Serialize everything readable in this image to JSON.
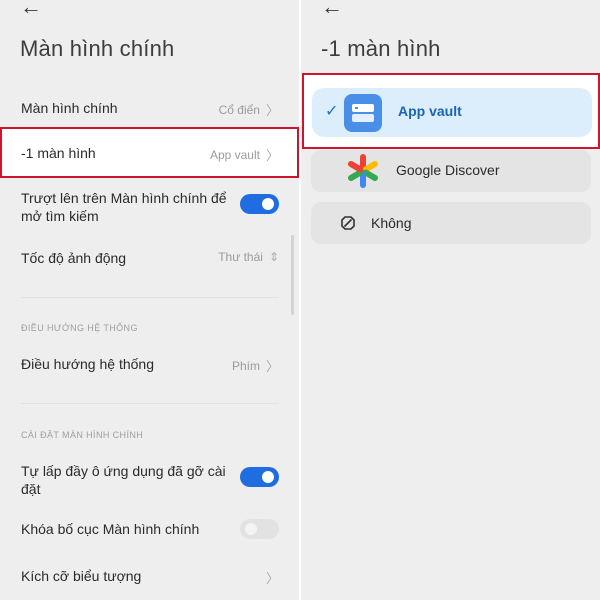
{
  "left": {
    "title": "Màn hình chính",
    "rows": [
      {
        "label": "Màn hình chính",
        "value": "Cổ điển"
      },
      {
        "label": "-1 màn hình",
        "value": "App vault"
      },
      {
        "label": "Trượt lên trên Màn hình chính để mở tìm kiếm",
        "toggle": "on"
      },
      {
        "label": "Tốc độ ảnh động",
        "value": "Thư thái"
      }
    ],
    "section_nav": {
      "header": "ĐIỀU HƯỚNG HỆ THỐNG",
      "row": {
        "label": "Điều hướng hệ thống",
        "value": "Phím"
      }
    },
    "section_home": {
      "header": "CÀI ĐẶT MÀN HÌNH CHÍNH",
      "rows": [
        {
          "label": "Tự lấp đầy ô ứng dụng đã gỡ cài đặt",
          "toggle": "on"
        },
        {
          "label": "Khóa bố cục Màn hình chính",
          "toggle": "off"
        },
        {
          "label": "Kích cỡ biểu tượng"
        }
      ]
    }
  },
  "right": {
    "title": "-1 màn hình",
    "options": [
      {
        "label": "App vault",
        "selected": true,
        "icon": "app-vault-icon"
      },
      {
        "label": "Google Discover",
        "selected": false,
        "icon": "google-discover-icon"
      },
      {
        "label": "Không",
        "selected": false,
        "icon": "block-icon"
      }
    ]
  },
  "colors": {
    "accent": "#1f6de0",
    "highlight_border": "#d0142c",
    "selected_bg": "#dceefb",
    "panel_bg": "#eeeeee"
  }
}
